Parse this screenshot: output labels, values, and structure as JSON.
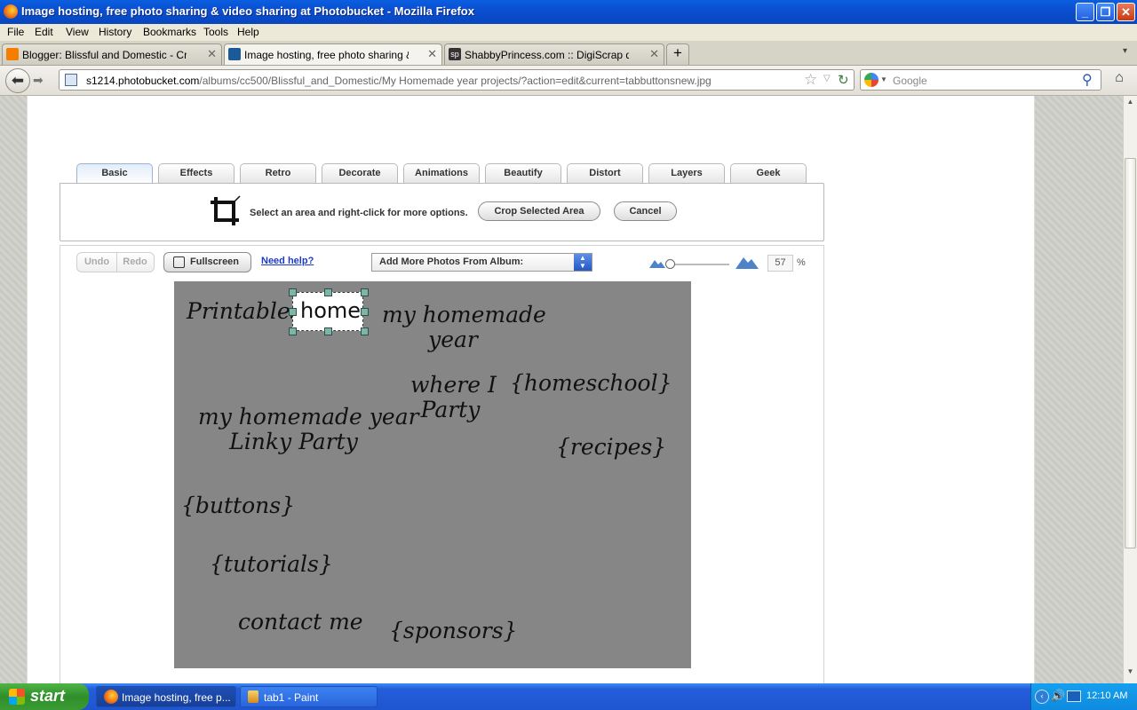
{
  "window": {
    "title": "Image hosting, free photo sharing & video sharing at Photobucket - Mozilla Firefox",
    "controls": {
      "minimize": "_",
      "maximize": "❐",
      "close": "✕"
    }
  },
  "menubar": [
    "File",
    "Edit",
    "View",
    "History",
    "Bookmarks",
    "Tools",
    "Help"
  ],
  "browser_tabs": [
    {
      "title": "Blogger: Blissful and Domestic - Create P...",
      "favicon_color": "#f57d00"
    },
    {
      "title": "Image hosting, free photo sharing & vide...",
      "favicon_color": "#1c5b99"
    },
    {
      "title": "ShabbyPrincess.com :: DigiScrap downlo...",
      "favicon_color": "#333333"
    }
  ],
  "new_tab_label": "+",
  "address": {
    "domain": "s1214.photobucket.com",
    "path": "/albums/cc500/Blissful_and_Domestic/My Homemade year projects/?action=edit&current=tabbuttonsnew.jpg"
  },
  "search": {
    "placeholder": "Google"
  },
  "editor": {
    "tabs": [
      "Basic",
      "Effects",
      "Retro",
      "Decorate",
      "Animations",
      "Beautify",
      "Distort",
      "Layers",
      "Geek"
    ],
    "active_tab": "Basic",
    "crop_hint": "Select an area and right-click for more options.",
    "crop_button": "Crop Selected Area",
    "cancel_button": "Cancel",
    "undo": "Undo",
    "redo": "Redo",
    "fullscreen": "Fullscreen",
    "help": "Need help?",
    "album_select": "Add More Photos From Album:",
    "zoom_value": "57",
    "zoom_unit": "%"
  },
  "canvas_words": {
    "printables": "Printables",
    "home": "home",
    "myhome_1": "my homemade",
    "myhome_2": "year",
    "where_1": "where I",
    "where_2": "Party",
    "homeschool": "{homeschool}",
    "linky_1": "my homemade year",
    "linky_2": "Linky Party",
    "recipes": "{recipes}",
    "buttons": "{buttons}",
    "tutorials": "{tutorials}",
    "contact": "contact me",
    "sponsors": "{sponsors}"
  },
  "taskbar": {
    "start": "start",
    "items": [
      "Image hosting, free p...",
      "tab1 - Paint"
    ],
    "clock": "12:10 AM"
  },
  "colors": {
    "titlebar": "#0a5fe0",
    "taskbar": "#245edb",
    "start": "#3a9b34",
    "canvas": "#868686",
    "link": "#1a3bcc"
  }
}
